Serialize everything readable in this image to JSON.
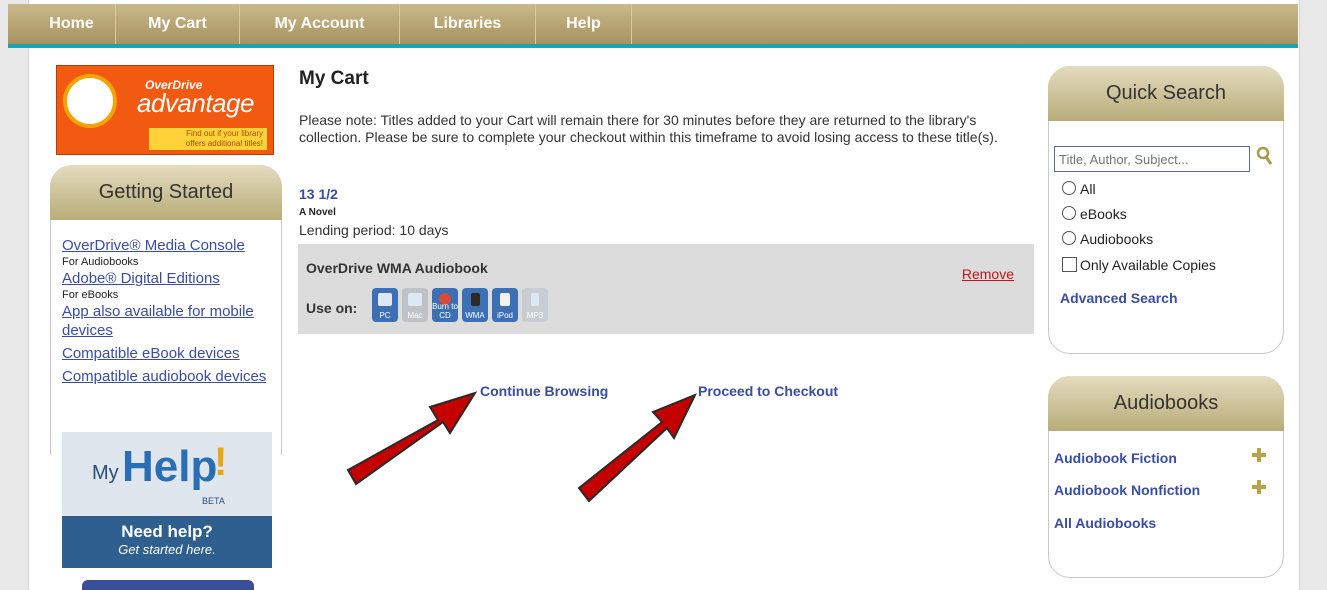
{
  "nav": {
    "items": [
      {
        "label": "Home"
      },
      {
        "label": "My Cart"
      },
      {
        "label": "My Account"
      },
      {
        "label": "Libraries"
      },
      {
        "label": "Help"
      }
    ]
  },
  "advantage_banner": {
    "brand": "OverDrive",
    "word": "advantage",
    "tagline_line1": "Find out if your library",
    "tagline_line2": "offers additional titles!"
  },
  "getting_started": {
    "title": "Getting Started",
    "links": [
      {
        "label": "OverDrive® Media Console",
        "note": "For Audiobooks"
      },
      {
        "label": "Adobe® Digital Editions",
        "note": "For eBooks"
      },
      {
        "label": "App also available for mobile devices",
        "note": ""
      },
      {
        "label": "Compatible eBook devices",
        "note": ""
      },
      {
        "label": "Compatible audiobook devices",
        "note": ""
      }
    ]
  },
  "myhelp": {
    "my": "My",
    "help": "Help",
    "beta": "BETA",
    "need": "Need help?",
    "get": "Get started here."
  },
  "cart": {
    "title": "My Cart",
    "note": "Please note: Titles added to your Cart will remain there for 30 minutes before they are returned to the library's collection. Please be sure to complete your checkout within this timeframe to avoid losing access to these title(s).",
    "item_title": "13 1/2",
    "item_subtitle": "A Novel",
    "lending": "Lending period: 10 days",
    "format": "OverDrive WMA Audiobook",
    "remove": "Remove",
    "use_on": "Use on:",
    "devices": [
      {
        "label": "PC",
        "icon": "pc-icon",
        "enabled": true
      },
      {
        "label": "Mac",
        "icon": "mac-icon",
        "enabled": false
      },
      {
        "label": "Burn to CD",
        "icon": "burn-cd-icon",
        "enabled": true
      },
      {
        "label": "WMA",
        "icon": "wma-player-icon",
        "enabled": true
      },
      {
        "label": "iPod",
        "icon": "ipod-icon",
        "enabled": true
      },
      {
        "label": "MP3",
        "icon": "mp3-player-icon",
        "enabled": false
      }
    ],
    "continue": "Continue Browsing",
    "checkout": "Proceed to Checkout"
  },
  "quick_search": {
    "title": "Quick Search",
    "placeholder": "Title, Author, Subject...",
    "options": [
      "All",
      "eBooks",
      "Audiobooks"
    ],
    "only_available": "Only Available Copies",
    "advanced": "Advanced Search"
  },
  "audiobooks": {
    "title": "Audiobooks",
    "links": [
      "Audiobook Fiction",
      "Audiobook Nonfiction",
      "All Audiobooks"
    ]
  },
  "colors": {
    "nav": "#b8a572",
    "accent_teal": "#1aa3b4",
    "link": "#3a4da0",
    "remove": "#c0151b",
    "arrow": "#c40000"
  }
}
